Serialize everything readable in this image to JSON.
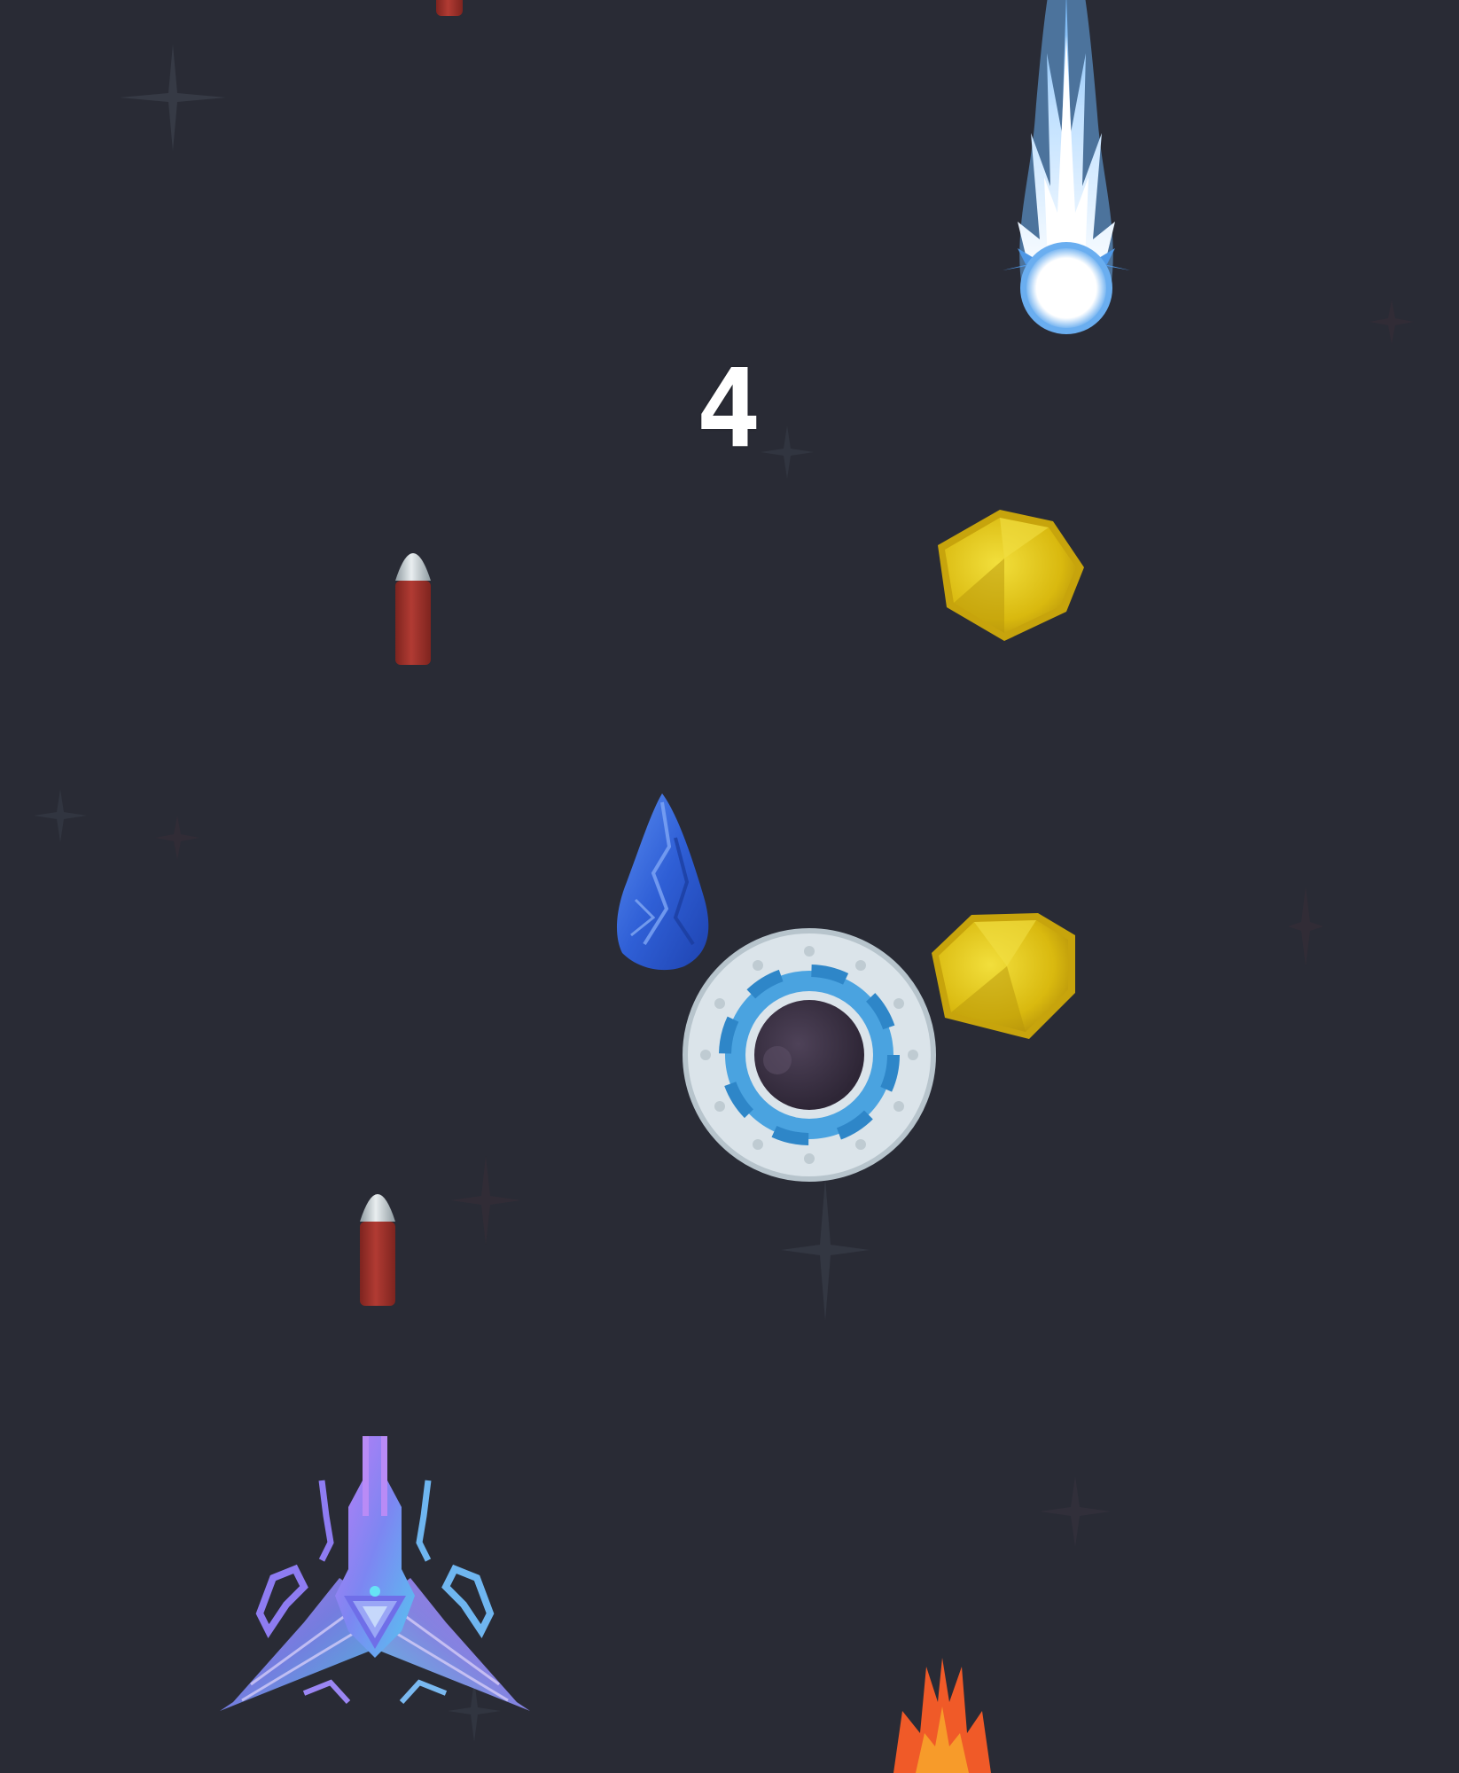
{
  "hud": {
    "score": "4"
  },
  "colors": {
    "background": "#292b35",
    "bullet_body": "#a3332d",
    "bullet_tip": "#b9c4c9",
    "gold_rock": "#e6c81e",
    "blue_crystal": "#2f5fd6",
    "comet_core": "#ffffff",
    "comet_glow": "#6aaef0",
    "portal_ring": "#dbe4ea",
    "portal_inner_ring": "#4aa3e0",
    "portal_core": "#3e3446",
    "flame_outer": "#f05a28",
    "flame_inner": "#f79b2a",
    "ship_primary": "#8a7cf2",
    "ship_secondary": "#5fc3f0"
  },
  "sprites": {
    "player_ship": "player-spaceship",
    "enemy_projectile": "blue-comet",
    "bullets": [
      "bullet",
      "bullet",
      "bullet"
    ],
    "pickups": [
      "gold-rock",
      "gold-rock",
      "blue-crystal"
    ],
    "portal": "warp-portal",
    "hazard": "fire-flame"
  }
}
